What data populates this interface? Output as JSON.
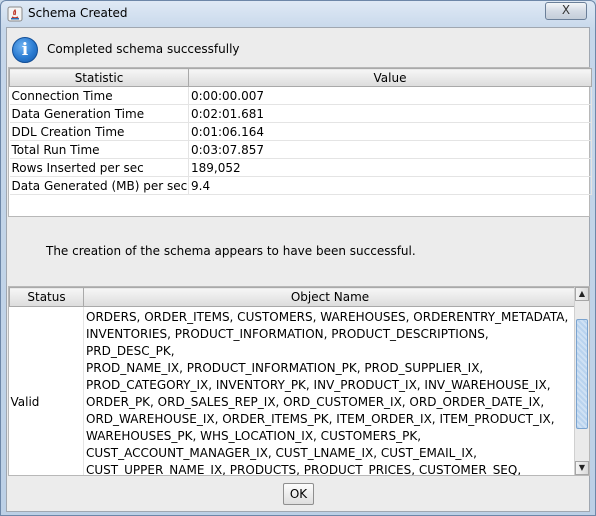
{
  "window": {
    "title": "Schema Created",
    "close_glyph": "X"
  },
  "info": {
    "icon": "info-icon",
    "glyph": "i",
    "message": "Completed schema successfully"
  },
  "stats": {
    "headers": [
      "Statistic",
      "Value"
    ],
    "rows": [
      [
        "Connection Time",
        "0:00:00.007"
      ],
      [
        "Data Generation Time",
        "0:02:01.681"
      ],
      [
        "DDL Creation Time",
        "0:01:06.164"
      ],
      [
        "Total Run Time",
        "0:03:07.857"
      ],
      [
        "Rows Inserted per sec",
        "189,052"
      ],
      [
        "Data Generated (MB) per sec",
        "9.4"
      ]
    ]
  },
  "success_message": "The creation of the schema appears to have been successful.",
  "objects": {
    "headers": [
      "Status",
      "Object Name"
    ],
    "status": "Valid",
    "names": "ORDERS, ORDER_ITEMS, CUSTOMERS, WAREHOUSES, ORDERENTRY_METADATA,\nINVENTORIES, PRODUCT_INFORMATION, PRODUCT_DESCRIPTIONS, PRD_DESC_PK,\nPROD_NAME_IX, PRODUCT_INFORMATION_PK, PROD_SUPPLIER_IX,\nPROD_CATEGORY_IX, INVENTORY_PK, INV_PRODUCT_IX, INV_WAREHOUSE_IX,\nORDER_PK, ORD_SALES_REP_IX, ORD_CUSTOMER_IX, ORD_ORDER_DATE_IX,\nORD_WAREHOUSE_IX, ORDER_ITEMS_PK, ITEM_ORDER_IX, ITEM_PRODUCT_IX,\nWAREHOUSES_PK, WHS_LOCATION_IX, CUSTOMERS_PK,\nCUST_ACCOUNT_MANAGER_IX, CUST_LNAME_IX, CUST_EMAIL_IX,\nCUST_UPPER_NAME_IX, PRODUCTS, PRODUCT_PRICES, CUSTOMER_SEQ,\nORDERS_SEQ, ORDERENTRY,"
  },
  "ok_label": "OK"
}
